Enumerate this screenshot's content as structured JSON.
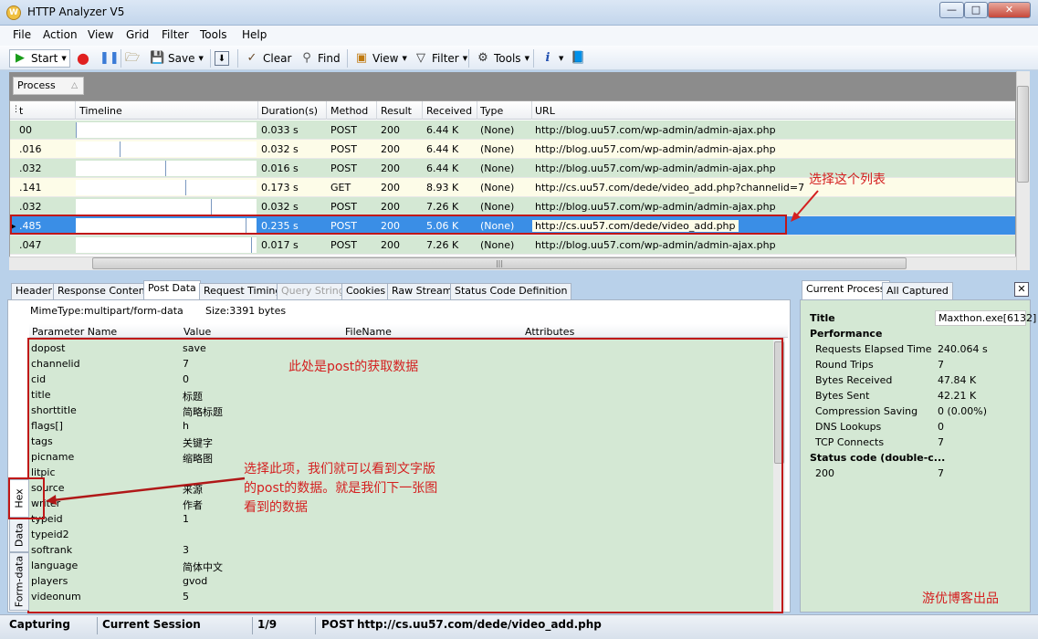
{
  "window": {
    "title": "HTTP Analyzer V5"
  },
  "menu": [
    "File",
    "Action",
    "View",
    "Grid",
    "Filter",
    "Tools",
    "Help"
  ],
  "toolbar": {
    "start": "Start",
    "save": "Save",
    "clear": "Clear",
    "find": "Find",
    "view": "View",
    "filter": "Filter",
    "tools": "Tools"
  },
  "group_panel": {
    "chip": "Process"
  },
  "grid": {
    "columns": [
      "t",
      "Timeline",
      "Duration(s)",
      "Method",
      "Result",
      "Received",
      "Type",
      "URL"
    ],
    "rows": [
      {
        "t": "00",
        "duration": "0.033 s",
        "method": "POST",
        "result": "200",
        "received": "6.44 K",
        "type": "(None)",
        "url": "http://blog.uu57.com/wp-admin/admin-ajax.php",
        "style": "green"
      },
      {
        "t": ".016",
        "duration": "0.032 s",
        "method": "POST",
        "result": "200",
        "received": "6.44 K",
        "type": "(None)",
        "url": "http://blog.uu57.com/wp-admin/admin-ajax.php",
        "style": "yellow"
      },
      {
        "t": ".032",
        "duration": "0.016 s",
        "method": "POST",
        "result": "200",
        "received": "6.44 K",
        "type": "(None)",
        "url": "http://blog.uu57.com/wp-admin/admin-ajax.php",
        "style": "green"
      },
      {
        "t": ".141",
        "duration": "0.173 s",
        "method": "GET",
        "result": "200",
        "received": "8.93 K",
        "type": "(None)",
        "url": "http://cs.uu57.com/dede/video_add.php?channelid=7",
        "style": "yellow"
      },
      {
        "t": ".032",
        "duration": "0.032 s",
        "method": "POST",
        "result": "200",
        "received": "7.26 K",
        "type": "(None)",
        "url": "http://blog.uu57.com/wp-admin/admin-ajax.php",
        "style": "green"
      },
      {
        "t": ".485",
        "duration": "0.235 s",
        "method": "POST",
        "result": "200",
        "received": "5.06 K",
        "type": "(None)",
        "url": "http://cs.uu57.com/dede/video_add.php",
        "style": "selected"
      },
      {
        "t": ".047",
        "duration": "0.017 s",
        "method": "POST",
        "result": "200",
        "received": "7.26 K",
        "type": "(None)",
        "url": "http://blog.uu57.com/wp-admin/admin-ajax.php",
        "style": "green"
      }
    ]
  },
  "detail_tabs": [
    "Header",
    "Response Content",
    "Post Data",
    "Request Timing",
    "Query String",
    "Cookies",
    "Raw Stream",
    "Status Code Definition"
  ],
  "post_data": {
    "mime": "MimeType:multipart/form-data",
    "size": "Size:3391 bytes",
    "columns": [
      "Parameter Name",
      "Value",
      "FileName",
      "Attributes"
    ],
    "rows": [
      {
        "name": "dopost",
        "value": "save"
      },
      {
        "name": "channelid",
        "value": "7"
      },
      {
        "name": "cid",
        "value": "0"
      },
      {
        "name": "title",
        "value": "标题"
      },
      {
        "name": "shorttitle",
        "value": "简略标题"
      },
      {
        "name": "flags[]",
        "value": "h"
      },
      {
        "name": "tags",
        "value": "关键字"
      },
      {
        "name": "picname",
        "value": "缩略图"
      },
      {
        "name": "litpic",
        "value": ""
      },
      {
        "name": "source",
        "value": "来源"
      },
      {
        "name": "writer",
        "value": "作者"
      },
      {
        "name": "typeid",
        "value": "1"
      },
      {
        "name": "typeid2",
        "value": ""
      },
      {
        "name": "softrank",
        "value": "3"
      },
      {
        "name": "language",
        "value": "简体中文"
      },
      {
        "name": "players",
        "value": "gvod"
      },
      {
        "name": "videonum",
        "value": "5"
      }
    ],
    "side_tabs": [
      "Hex",
      "Data",
      "Form-data"
    ]
  },
  "right_pane": {
    "tabs": [
      "Current Process",
      "All Captured"
    ],
    "title_label": "Title",
    "title_value": "Maxthon.exe[6132]",
    "performance_label": "Performance",
    "stats": [
      {
        "label": "Requests Elapsed Time",
        "value": "240.064 s"
      },
      {
        "label": "Round Trips",
        "value": "7"
      },
      {
        "label": "Bytes Received",
        "value": "47.84 K"
      },
      {
        "label": "Bytes Sent",
        "value": "42.21 K"
      },
      {
        "label": "Compression Saving",
        "value": "0  (0.00%)"
      },
      {
        "label": "DNS Lookups",
        "value": "0"
      },
      {
        "label": "TCP Connects",
        "value": "7"
      }
    ],
    "status_label": "Status code (double-c...",
    "status_rows": [
      {
        "code": "200",
        "count": "7"
      }
    ]
  },
  "annotations": {
    "select_list": "选择这个列表",
    "post_data_note": "此处是post的获取数据",
    "hex_note": "选择此项，我们就可以看到文字版的post的数据。就是我们下一张图看到的数据",
    "watermark": "游优博客出品"
  },
  "status": {
    "capturing": "Capturing",
    "session": "Current Session",
    "page": "1/9",
    "method": "POST",
    "url": "http://cs.uu57.com/dede/video_add.php"
  }
}
